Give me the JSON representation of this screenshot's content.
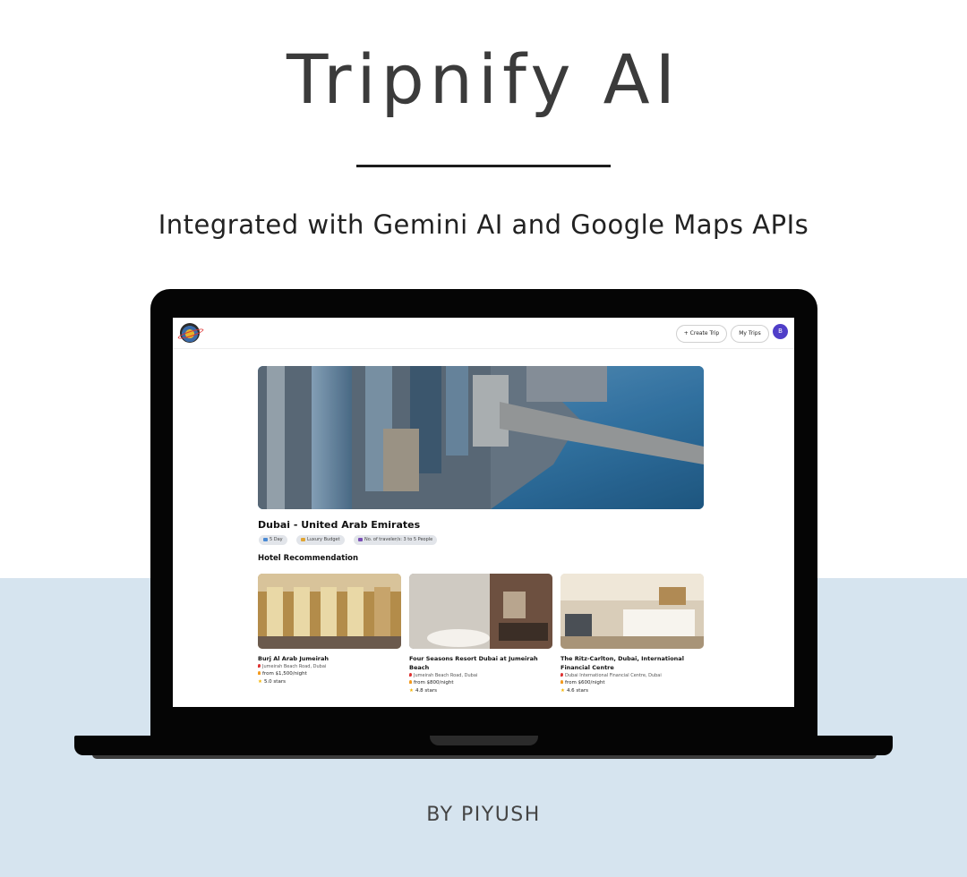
{
  "poster": {
    "title": "Tripnify AI",
    "subtitle": "Integrated with Gemini AI and Google Maps APIs",
    "byline": "BY PIYUSH"
  },
  "colors": {
    "band": "#d6e4ef",
    "accent_avatar": "#4f3ec8",
    "chip_bg": "#e2e5ea",
    "star": "#f4b400"
  },
  "app": {
    "header": {
      "logo_icon": "globe-logo-icon",
      "create_trip_label": "+ Create Trip",
      "my_trips_label": "My Trips",
      "avatar_initial": "B"
    },
    "destination": {
      "title": "Dubai - United Arab Emirates",
      "chips": {
        "days": "5 Day",
        "budget": "Luxury Budget",
        "travelers": "No. of traveler/s: 3 to 5 People"
      }
    },
    "section_title": "Hotel Recommendation",
    "hotels": [
      {
        "name": "Burj Al Arab Jumeirah",
        "address": "Jumeirah Beach Road, Dubai",
        "price": "from $1,500/night",
        "rating": "5.0 stars"
      },
      {
        "name": "Four Seasons Resort Dubai at Jumeirah Beach",
        "address": "Jumeirah Beach Road, Dubai",
        "price": "from $800/night",
        "rating": "4.8 stars"
      },
      {
        "name": "The Ritz-Carlton, Dubai, International Financial Centre",
        "address": "Dubai International Financial Centre, Dubai",
        "price": "from $600/night",
        "rating": "4.6 stars"
      }
    ]
  }
}
